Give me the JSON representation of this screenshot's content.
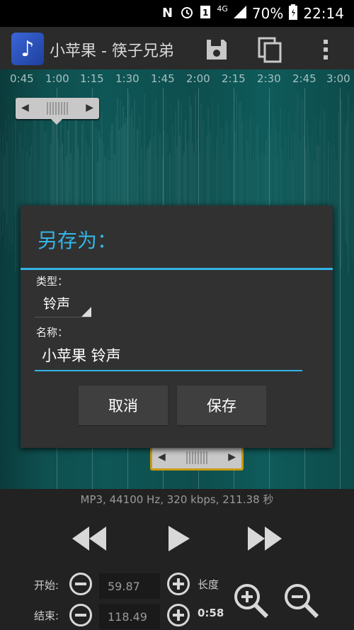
{
  "status": {
    "battery": "70%",
    "time": "22:14",
    "network": "4G",
    "sim": "1",
    "icons": [
      "nfc-icon",
      "alarm-icon",
      "sim-icon",
      "signal-icon",
      "battery-icon"
    ]
  },
  "app": {
    "title": "小苹果 - 筷子兄弟",
    "icons": [
      "music-note-icon",
      "save-icon",
      "copy-icon",
      "overflow-menu-icon"
    ]
  },
  "timeline": {
    "ticks": [
      "0:45",
      "1:00",
      "1:15",
      "1:30",
      "1:45",
      "2:00",
      "2:15",
      "2:30",
      "2:45",
      "3:00"
    ]
  },
  "dialog": {
    "title": "另存为：",
    "type_label": "类型：",
    "type_value": "铃声",
    "name_label": "名称：",
    "name_value": "小苹果 铃声",
    "cancel": "取消",
    "save": "保存"
  },
  "player": {
    "info": "MP3, 44100 Hz, 320 kbps, 211.38 秒",
    "start_label": "开始:",
    "start_value": "59.87",
    "end_label": "结束:",
    "end_value": "118.49",
    "length_label": "长度",
    "length_value": "0:58",
    "icons": [
      "rewind-icon",
      "play-icon",
      "fast-forward-icon",
      "zoom-in-icon",
      "zoom-out-icon",
      "minus-icon",
      "plus-icon"
    ]
  }
}
